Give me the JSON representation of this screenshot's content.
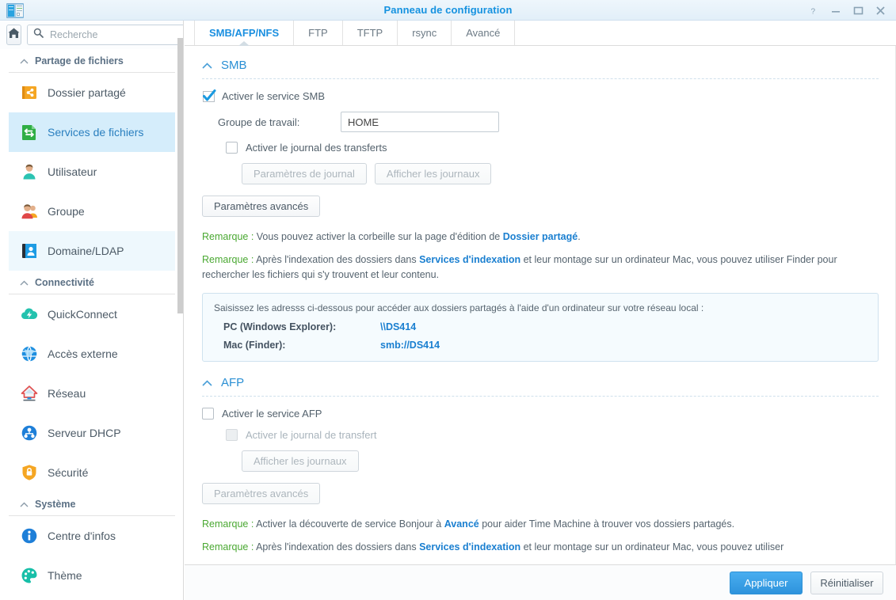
{
  "window": {
    "title": "Panneau de configuration",
    "icon": "control-panel-icon",
    "controls": {
      "help": "?",
      "minimize": "–",
      "maximize": "▭",
      "close": "✕"
    }
  },
  "sidebar": {
    "home_button": "home-icon",
    "search": {
      "placeholder": "Recherche",
      "value": ""
    },
    "groups": [
      {
        "label": "Partage de fichiers",
        "items": [
          {
            "label": "Dossier partagé",
            "icon": "shared-folder-icon",
            "state": "normal"
          },
          {
            "label": "Services de fichiers",
            "icon": "file-services-icon",
            "state": "active"
          },
          {
            "label": "Utilisateur",
            "icon": "user-icon",
            "state": "normal"
          },
          {
            "label": "Groupe",
            "icon": "group-icon",
            "state": "normal"
          },
          {
            "label": "Domaine/LDAP",
            "icon": "domain-ldap-icon",
            "state": "hover"
          }
        ]
      },
      {
        "label": "Connectivité",
        "items": [
          {
            "label": "QuickConnect",
            "icon": "quickconnect-icon",
            "state": "normal"
          },
          {
            "label": "Accès externe",
            "icon": "external-access-icon",
            "state": "normal"
          },
          {
            "label": "Réseau",
            "icon": "network-icon",
            "state": "normal"
          },
          {
            "label": "Serveur DHCP",
            "icon": "dhcp-server-icon",
            "state": "normal"
          },
          {
            "label": "Sécurité",
            "icon": "security-shield-icon",
            "state": "normal"
          }
        ]
      },
      {
        "label": "Système",
        "items": [
          {
            "label": "Centre d'infos",
            "icon": "info-center-icon",
            "state": "normal"
          },
          {
            "label": "Thème",
            "icon": "theme-palette-icon",
            "state": "normal"
          }
        ]
      }
    ]
  },
  "tabs": [
    {
      "label": "SMB/AFP/NFS",
      "active": true
    },
    {
      "label": "FTP",
      "active": false
    },
    {
      "label": "TFTP",
      "active": false
    },
    {
      "label": "rsync",
      "active": false
    },
    {
      "label": "Avancé",
      "active": false
    }
  ],
  "smb": {
    "section_title": "SMB",
    "enable_label": "Activer le service SMB",
    "enable_checked": true,
    "workgroup_label": "Groupe de travail:",
    "workgroup_value": "HOME",
    "transfer_log_label": "Activer le journal des transferts",
    "transfer_log_checked": false,
    "log_settings_button": "Paramètres de journal",
    "view_logs_button": "Afficher les journaux",
    "advanced_button": "Paramètres avancés",
    "note1_lead": "Remarque :",
    "note1_a": " Vous pouvez activer la corbeille sur la page d'édition de ",
    "note1_link": "Dossier partagé",
    "note1_b": ".",
    "note2_lead": "Remarque :",
    "note2_a": " Après l'indexation des dossiers dans ",
    "note2_link": "Services d'indexation",
    "note2_b": " et leur montage sur un ordinateur Mac, vous pouvez utiliser Finder pour rechercher les fichiers qui s'y trouvent et leur contenu.",
    "infobox_title": "Saisissez les adresss ci-dessous pour accéder aux dossiers partagés à l'aide d'un ordinateur sur votre réseau local :",
    "infobox_rows": [
      {
        "key": "PC (Windows Explorer):",
        "value": "\\\\DS414"
      },
      {
        "key": "Mac (Finder):",
        "value": "smb://DS414"
      }
    ]
  },
  "afp": {
    "section_title": "AFP",
    "enable_label": "Activer le service AFP",
    "enable_checked": false,
    "transfer_log_label": "Activer le journal de transfert",
    "transfer_log_checked": false,
    "view_logs_button": "Afficher les journaux",
    "advanced_button": "Paramètres avancés",
    "note1_lead": "Remarque :",
    "note1_a": " Activer la découverte de service Bonjour à ",
    "note1_link": "Avancé",
    "note1_b": " pour aider Time Machine à trouver vos dossiers partagés.",
    "note2_lead": "Remarque :",
    "note2_a": " Après l'indexation des dossiers dans ",
    "note2_link": "Services d'indexation",
    "note2_b": " et leur montage sur un ordinateur Mac, vous pouvez utiliser"
  },
  "footer": {
    "apply_label": "Appliquer",
    "reset_label": "Réinitialiser"
  },
  "colors": {
    "accent": "#1a8fe0",
    "link": "#1a7fd0",
    "note_lead": "#4aa832",
    "active_row_bg": "#d5edfb",
    "primary_button": "#2e93dc"
  }
}
